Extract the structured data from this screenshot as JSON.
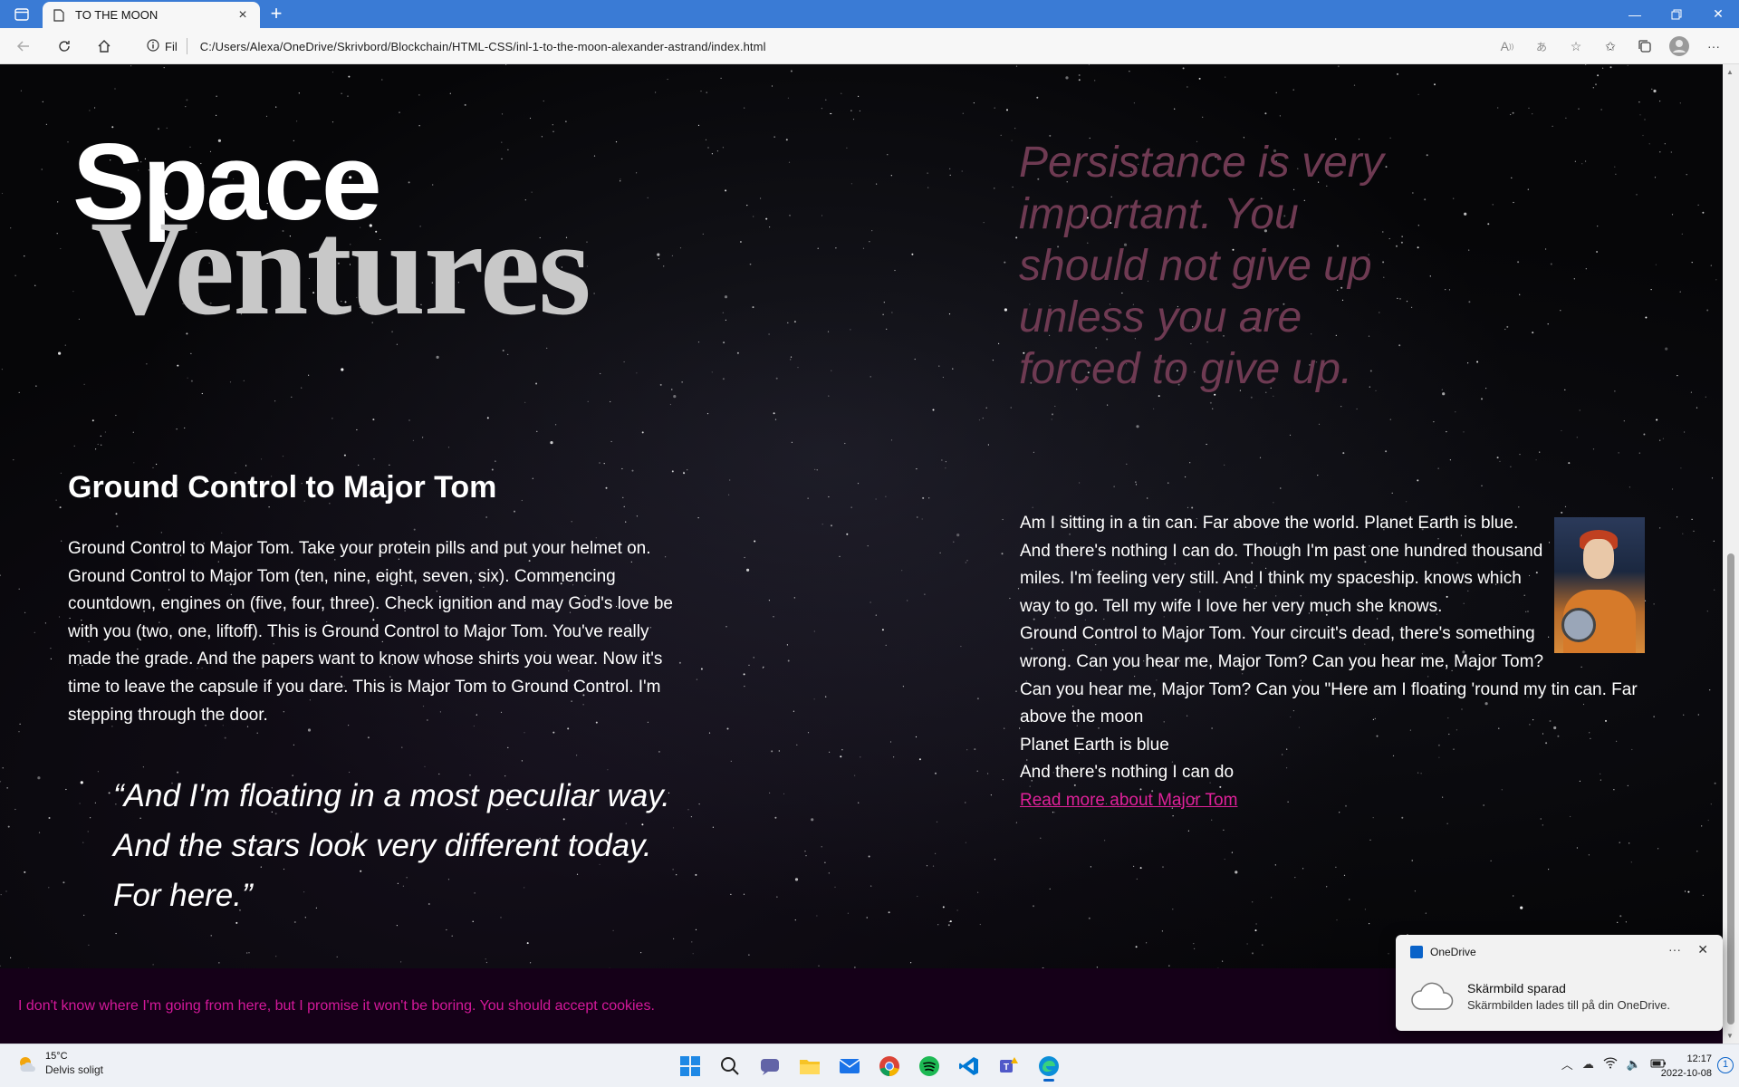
{
  "browser": {
    "tab_title": "TO THE MOON",
    "site_info_label": "Fil",
    "url": "C:/Users/Alexa/OneDrive/Skrivbord/Blockchain/HTML-CSS/inl-1-to-the-moon-alexander-astrand/index.html"
  },
  "page": {
    "logo_top": "Space",
    "logo_bottom": "Ventures",
    "top_quote": "Persistance is very important. You should not give up unless you are forced to give up.",
    "section_heading": "Ground Control to Major Tom",
    "section_body": "Ground Control to Major Tom. Take your protein pills and put your helmet on. Ground Control to Major Tom (ten, nine, eight, seven, six). Commencing countdown, engines on (five, four, three). Check ignition and may God's love be with you (two, one, liftoff). This is Ground Control to Major Tom. You've really made the grade. And the papers want to know whose shirts you wear. Now it's time to leave the capsule if you dare. This is Major Tom to Ground Control. I'm stepping through the door.",
    "pull_quote": "“And I'm floating in a most peculiar way. And the stars look very different today. For here.”",
    "right_paragraph_1": "Am I sitting in a tin can. Far above the world. Planet Earth is blue. And there's nothing I can do. Though I'm past one hundred thousand miles. I'm feeling very still. And I think my spaceship. knows which way to go. Tell my wife I love her very much she knows.",
    "right_paragraph_2": "Ground Control to Major Tom. Your circuit's dead, there's something wrong. Can you hear me, Major Tom? Can you hear me, Major Tom? Can you hear me, Major Tom? Can you \"Here am I floating 'round my tin can. Far above the moon",
    "right_line_3": "Planet Earth is blue",
    "right_line_4": "And there's nothing I can do",
    "read_more": "Read more about Major Tom",
    "cookie_text": "I don't know where I'm going from here, but I promise it won't be boring. You should accept cookies."
  },
  "toast": {
    "app": "OneDrive",
    "title": "Skärmbild sparad",
    "message": "Skärmbilden lades till på din OneDrive."
  },
  "taskbar": {
    "temperature": "15°C",
    "weather": "Delvis soligt",
    "time": "12:17",
    "date": "2022-10-08",
    "notifications": "1"
  },
  "colors": {
    "accent": "#3a7bd5",
    "quote_color": "#6e3a52",
    "link_color": "#e0219a",
    "cookie_bg": "#150018"
  },
  "icons": [
    "back-icon",
    "refresh-icon",
    "home-icon",
    "info-icon",
    "read-aloud-icon",
    "translate-icon",
    "favorite-add-icon",
    "favorites-icon",
    "collections-icon",
    "profile-icon",
    "more-icon"
  ]
}
